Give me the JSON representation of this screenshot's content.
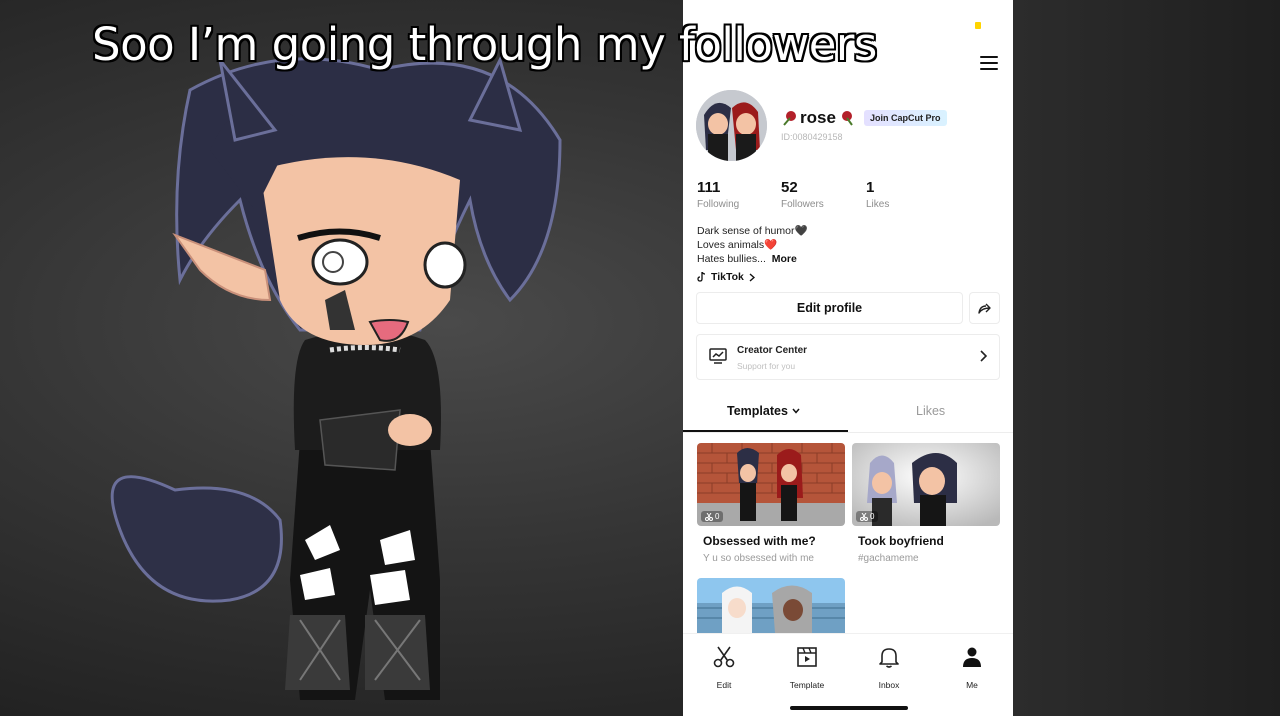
{
  "overlay": {
    "caption": "Soo I’m going through my followers"
  },
  "profile": {
    "username": "rose",
    "badge": "Join CapCut Pro",
    "id": "ID:0080429158",
    "stats": [
      {
        "value": "111",
        "label": "Following"
      },
      {
        "value": "52",
        "label": "Followers"
      },
      {
        "value": "1",
        "label": "Likes"
      }
    ],
    "bio": {
      "line1": "Dark sense of humor🖤",
      "line2": "Loves animals❤️",
      "line3": "Hates bullies...",
      "more": "More"
    },
    "tiktok_link": "TikTok",
    "edit_profile": "Edit profile",
    "creator_center": {
      "title": "Creator Center",
      "subtitle": "Support for you"
    }
  },
  "tabs": {
    "templates": "Templates",
    "likes": "Likes"
  },
  "templates": [
    {
      "title": "Obsessed with me?",
      "subtitle": "Y u so obsessed with me",
      "uses": "0"
    },
    {
      "title": "Took boyfriend",
      "subtitle": "#gachameme",
      "uses": "0"
    }
  ],
  "bottom_nav": [
    {
      "label": "Edit",
      "icon": "scissors-icon"
    },
    {
      "label": "Template",
      "icon": "template-icon"
    },
    {
      "label": "Inbox",
      "icon": "bell-icon"
    },
    {
      "label": "Me",
      "icon": "person-icon"
    }
  ],
  "colors": {
    "status_dot": "#ffd400",
    "tab_underline": "#111111",
    "pro_badge": "#e4e0ff"
  }
}
